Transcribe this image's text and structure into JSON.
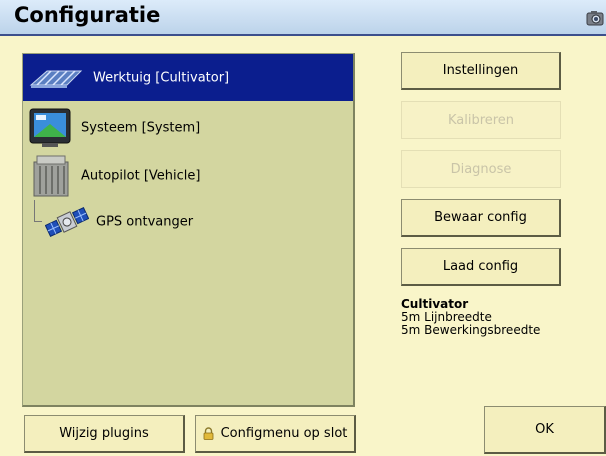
{
  "window": {
    "title": "Configuratie",
    "camera_icon": "camera-icon"
  },
  "tree": {
    "items": [
      {
        "label": "Werktuig [Cultivator]",
        "icon": "implement-icon",
        "selected": true
      },
      {
        "label": "Systeem [System]",
        "icon": "display-icon",
        "selected": false
      },
      {
        "label": "Autopilot [Vehicle]",
        "icon": "autopilot-controller-icon",
        "selected": false
      },
      {
        "label": "GPS ontvanger",
        "icon": "satellite-icon",
        "selected": false
      }
    ]
  },
  "actions": {
    "settings": "Instellingen",
    "calibrate": "Kalibreren",
    "diagnose": "Diagnose",
    "save_config": "Bewaar config",
    "load_config": "Laad config"
  },
  "info": {
    "name": "Cultivator",
    "line1": "5m Lijnbreedte",
    "line2": "5m Bewerkingsbreedte"
  },
  "footer": {
    "plugins": "Wijzig plugins",
    "lock": "Configmenu op slot",
    "ok": "OK"
  },
  "colors": {
    "background": "#f9f5c9",
    "selection": "#0b1e8e",
    "panel": "#d3d6a0",
    "title_bar": "#c8dcf0"
  }
}
